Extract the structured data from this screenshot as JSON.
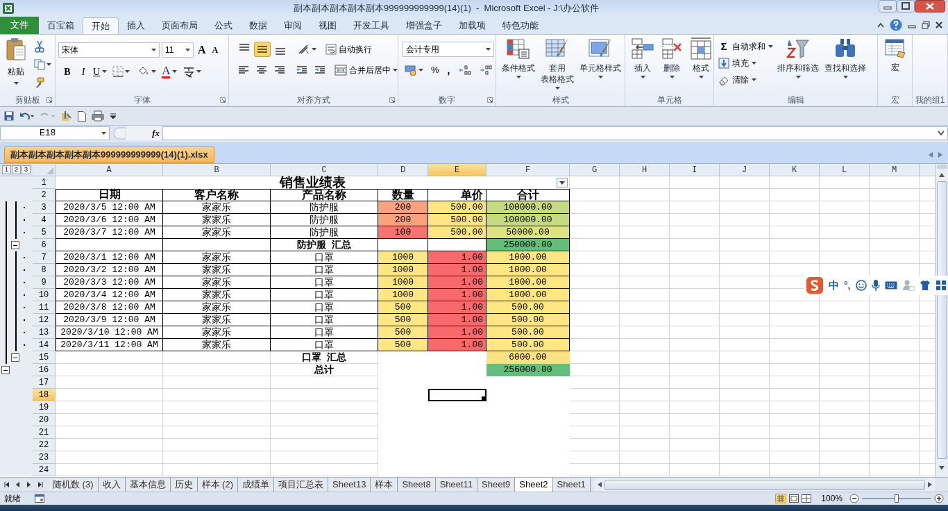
{
  "window": {
    "title": "副本副本副本副本副本999999999999(14)(1)  -  Microsoft Excel - J:\\办公软件"
  },
  "menu_tabs": [
    {
      "label": "文件",
      "kind": "file",
      "selected": false
    },
    {
      "label": "百宝箱",
      "kind": "tab",
      "selected": false
    },
    {
      "label": "开始",
      "kind": "tab",
      "selected": true
    },
    {
      "label": "插入",
      "kind": "tab",
      "selected": false
    },
    {
      "label": "页面布局",
      "kind": "tab",
      "selected": false
    },
    {
      "label": "公式",
      "kind": "tab",
      "selected": false
    },
    {
      "label": "数据",
      "kind": "tab",
      "selected": false
    },
    {
      "label": "审阅",
      "kind": "tab",
      "selected": false
    },
    {
      "label": "视图",
      "kind": "tab",
      "selected": false
    },
    {
      "label": "开发工具",
      "kind": "tab",
      "selected": false
    },
    {
      "label": "增强盒子",
      "kind": "tab",
      "selected": false
    },
    {
      "label": "加载项",
      "kind": "tab",
      "selected": false
    },
    {
      "label": "特色功能",
      "kind": "tab",
      "selected": false
    }
  ],
  "ribbon": {
    "groups": [
      {
        "kind": "clipboard",
        "label": "剪贴板",
        "paste": "粘贴"
      },
      {
        "kind": "font",
        "label": "字体",
        "font_name": "宋体",
        "font_size": "11",
        "grow": "A",
        "shrink": "A",
        "bold": "B",
        "italic": "I",
        "underline": "U",
        "font_color": "A"
      },
      {
        "kind": "alignment",
        "label": "对齐方式",
        "vertical": [
          {
            "selected": false
          },
          {
            "selected": true
          },
          {
            "selected": false
          }
        ],
        "wrap": "自动换行",
        "merge": "合并后居中"
      },
      {
        "kind": "number",
        "label": "数字",
        "format": "会计专用",
        "percent": "%",
        "comma": ","
      },
      {
        "kind": "styles",
        "label": "样式",
        "buttons": [
          {
            "lines": [
              "条件格式"
            ]
          },
          {
            "lines": [
              "套用",
              "表格格式"
            ]
          },
          {
            "lines": [
              "单元格样式"
            ]
          }
        ]
      },
      {
        "kind": "cells",
        "label": "单元格",
        "buttons": [
          {
            "lines": [
              "插入"
            ]
          },
          {
            "lines": [
              "删除"
            ]
          },
          {
            "lines": [
              "格式"
            ]
          }
        ]
      },
      {
        "kind": "editing",
        "label": "编辑",
        "sum_glyph": "Σ",
        "small": [
          {
            "label": "自动求和"
          },
          {
            "label": "填充"
          },
          {
            "label": "清除"
          }
        ],
        "buttons": [
          {
            "lines": [
              "排序和筛选"
            ]
          },
          {
            "lines": [
              "查找和选择"
            ]
          }
        ]
      },
      {
        "kind": "macro",
        "label": "宏",
        "button": "宏"
      },
      {
        "kind": "empty",
        "label": "我的组1"
      }
    ]
  },
  "formula_bar": {
    "name_box": "E18",
    "fx": "fx"
  },
  "workbook_tab": {
    "label": "副本副本副本副本副本999999999999(14)(1).xlsx"
  },
  "sheet": {
    "outline_levels": [
      "1",
      "2",
      "3"
    ],
    "columns": [
      {
        "label": "A",
        "selected": false
      },
      {
        "label": "B",
        "selected": false
      },
      {
        "label": "C",
        "selected": false
      },
      {
        "label": "D",
        "selected": false
      },
      {
        "label": "E",
        "selected": true
      },
      {
        "label": "F",
        "selected": false
      },
      {
        "label": "G",
        "selected": false
      },
      {
        "label": "H",
        "selected": false
      },
      {
        "label": "I",
        "selected": false
      },
      {
        "label": "J",
        "selected": false
      },
      {
        "label": "K",
        "selected": false
      },
      {
        "label": "L",
        "selected": false
      },
      {
        "label": "M",
        "selected": false
      }
    ],
    "rows": [
      {
        "num": "1",
        "kind": "title",
        "selected": false,
        "title": "销售业绩表"
      },
      {
        "num": "2",
        "kind": "header",
        "selected": false,
        "bordered": true,
        "cells": [
          {
            "text": "日期"
          },
          {
            "text": "客户名称"
          },
          {
            "text": "产品名称"
          },
          {
            "text": "数量"
          },
          {
            "text": "单价"
          },
          {
            "text": "合计"
          }
        ]
      },
      {
        "num": "3",
        "kind": "detail",
        "selected": false,
        "bordered": true,
        "outline": {
          "kind": "detail"
        },
        "cells": [
          {
            "text": "2020/3/5 12:00 AM"
          },
          {
            "text": "家家乐"
          },
          {
            "text": "防护服"
          },
          {
            "text": "200",
            "color": "#f9a27c"
          },
          {
            "text": "500.00",
            "color": "#fee583"
          },
          {
            "text": "100000.00",
            "color": "#c6db81"
          }
        ]
      },
      {
        "num": "4",
        "kind": "detail",
        "selected": false,
        "bordered": true,
        "outline": {
          "kind": "detail"
        },
        "cells": [
          {
            "text": "2020/3/6 12:00 AM"
          },
          {
            "text": "家家乐"
          },
          {
            "text": "防护服"
          },
          {
            "text": "200",
            "color": "#f9a27c"
          },
          {
            "text": "500.00",
            "color": "#fee583"
          },
          {
            "text": "100000.00",
            "color": "#c6db81"
          }
        ]
      },
      {
        "num": "5",
        "kind": "detail",
        "selected": false,
        "bordered": true,
        "outline": {
          "kind": "detail"
        },
        "cells": [
          {
            "text": "2020/3/7 12:00 AM"
          },
          {
            "text": "家家乐"
          },
          {
            "text": "防护服"
          },
          {
            "text": "100",
            "color": "#f8736f"
          },
          {
            "text": "500.00",
            "color": "#fee583"
          },
          {
            "text": "50000.00",
            "color": "#dde283"
          }
        ]
      },
      {
        "num": "6",
        "kind": "subtotal",
        "selected": false,
        "bordered": true,
        "outline": {
          "kind": "group_toggle",
          "expanded": true
        },
        "cells": [
          {},
          {},
          {
            "text": "防护服  汇总"
          },
          {},
          {},
          {
            "text": "250000.00",
            "color": "#63be7b"
          }
        ]
      },
      {
        "num": "7",
        "kind": "detail",
        "selected": false,
        "bordered": true,
        "outline": {
          "kind": "detail"
        },
        "cells": [
          {
            "text": "2020/3/1 12:00 AM"
          },
          {
            "text": "家家乐"
          },
          {
            "text": "口罩"
          },
          {
            "text": "1000",
            "color": "#fee783"
          },
          {
            "text": "1.00",
            "color": "#f8696b"
          },
          {
            "text": "1000.00",
            "color": "#fee683"
          }
        ]
      },
      {
        "num": "8",
        "kind": "detail",
        "selected": false,
        "bordered": true,
        "outline": {
          "kind": "detail"
        },
        "cells": [
          {
            "text": "2020/3/2 12:00 AM"
          },
          {
            "text": "家家乐"
          },
          {
            "text": "口罩"
          },
          {
            "text": "1000",
            "color": "#fee783"
          },
          {
            "text": "1.00",
            "color": "#f8696b"
          },
          {
            "text": "1000.00",
            "color": "#fee683"
          }
        ]
      },
      {
        "num": "9",
        "kind": "detail",
        "selected": false,
        "bordered": true,
        "outline": {
          "kind": "detail"
        },
        "cells": [
          {
            "text": "2020/3/3 12:00 AM"
          },
          {
            "text": "家家乐"
          },
          {
            "text": "口罩"
          },
          {
            "text": "1000",
            "color": "#fee783"
          },
          {
            "text": "1.00",
            "color": "#f8696b"
          },
          {
            "text": "1000.00",
            "color": "#fee683"
          }
        ]
      },
      {
        "num": "10",
        "kind": "detail",
        "selected": false,
        "bordered": true,
        "outline": {
          "kind": "detail"
        },
        "cells": [
          {
            "text": "2020/3/4 12:00 AM"
          },
          {
            "text": "家家乐"
          },
          {
            "text": "口罩"
          },
          {
            "text": "1000",
            "color": "#fee783"
          },
          {
            "text": "1.00",
            "color": "#f8696b"
          },
          {
            "text": "1000.00",
            "color": "#fee683"
          }
        ]
      },
      {
        "num": "11",
        "kind": "detail",
        "selected": false,
        "bordered": true,
        "outline": {
          "kind": "detail"
        },
        "cells": [
          {
            "text": "2020/3/8 12:00 AM"
          },
          {
            "text": "家家乐"
          },
          {
            "text": "口罩"
          },
          {
            "text": "500",
            "color": "#fee783"
          },
          {
            "text": "1.00",
            "color": "#f8696b"
          },
          {
            "text": "500.00",
            "color": "#fee783"
          }
        ]
      },
      {
        "num": "12",
        "kind": "detail",
        "selected": false,
        "bordered": true,
        "outline": {
          "kind": "detail"
        },
        "cells": [
          {
            "text": "2020/3/9 12:00 AM"
          },
          {
            "text": "家家乐"
          },
          {
            "text": "口罩"
          },
          {
            "text": "500",
            "color": "#fee783"
          },
          {
            "text": "1.00",
            "color": "#f8696b"
          },
          {
            "text": "500.00",
            "color": "#fee783"
          }
        ]
      },
      {
        "num": "13",
        "kind": "detail",
        "selected": false,
        "bordered": true,
        "outline": {
          "kind": "detail"
        },
        "cells": [
          {
            "text": "2020/3/10 12:00 AM"
          },
          {
            "text": "家家乐"
          },
          {
            "text": "口罩"
          },
          {
            "text": "500",
            "color": "#fee783"
          },
          {
            "text": "1.00",
            "color": "#f8696b"
          },
          {
            "text": "500.00",
            "color": "#fee783"
          }
        ]
      },
      {
        "num": "14",
        "kind": "detail",
        "selected": false,
        "bordered": true,
        "outline": {
          "kind": "detail"
        },
        "cells": [
          {
            "text": "2020/3/11 12:00 AM"
          },
          {
            "text": "家家乐"
          },
          {
            "text": "口罩"
          },
          {
            "text": "500",
            "color": "#fee783"
          },
          {
            "text": "1.00",
            "color": "#f8696b"
          },
          {
            "text": "500.00",
            "color": "#fee783"
          }
        ]
      },
      {
        "num": "15",
        "kind": "subtotal",
        "selected": false,
        "bordered": false,
        "outline": {
          "kind": "group_toggle",
          "expanded": true
        },
        "cells": [
          {},
          {},
          {
            "text": "口罩  汇总"
          },
          {},
          {},
          {
            "text": "6000.00",
            "color": "#fde283"
          }
        ]
      },
      {
        "num": "16",
        "kind": "subtotal",
        "selected": false,
        "bordered": false,
        "outline": {
          "kind": "outer_toggle",
          "expanded": true
        },
        "cells": [
          {},
          {},
          {
            "text": "总计"
          },
          {},
          {},
          {
            "text": "256000.00",
            "color": "#63be7b"
          }
        ]
      },
      {
        "num": "17",
        "kind": "empty",
        "selected": false
      },
      {
        "num": "18",
        "kind": "empty",
        "selected": true
      },
      {
        "num": "19",
        "kind": "empty",
        "selected": false
      },
      {
        "num": "20",
        "kind": "empty",
        "selected": false
      },
      {
        "num": "21",
        "kind": "empty",
        "selected": false
      },
      {
        "num": "22",
        "kind": "empty",
        "selected": false
      },
      {
        "num": "23",
        "kind": "empty",
        "selected": false
      },
      {
        "num": "24",
        "kind": "empty",
        "selected": false
      }
    ]
  },
  "sheet_tabs": [
    {
      "label": "随机数 (3)",
      "selected": false
    },
    {
      "label": "收入",
      "selected": false
    },
    {
      "label": "基本信息",
      "selected": false
    },
    {
      "label": "历史",
      "selected": false
    },
    {
      "label": "样本 (2)",
      "selected": false
    },
    {
      "label": "成绩单",
      "selected": false
    },
    {
      "label": "项目汇总表",
      "selected": false
    },
    {
      "label": "Sheet13",
      "selected": false
    },
    {
      "label": "样本",
      "selected": false
    },
    {
      "label": "Sheet8",
      "selected": false
    },
    {
      "label": "Sheet11",
      "selected": false
    },
    {
      "label": "Sheet9",
      "selected": false
    },
    {
      "label": "Sheet2",
      "selected": true
    },
    {
      "label": "Sheet1",
      "selected": false
    }
  ],
  "status_bar": {
    "text": "就绪",
    "zoom": "100%",
    "zoom_slider": {
      "level": 0.5
    }
  },
  "ime_toolbar": {
    "mode": "中",
    "punctuation": "°,"
  }
}
